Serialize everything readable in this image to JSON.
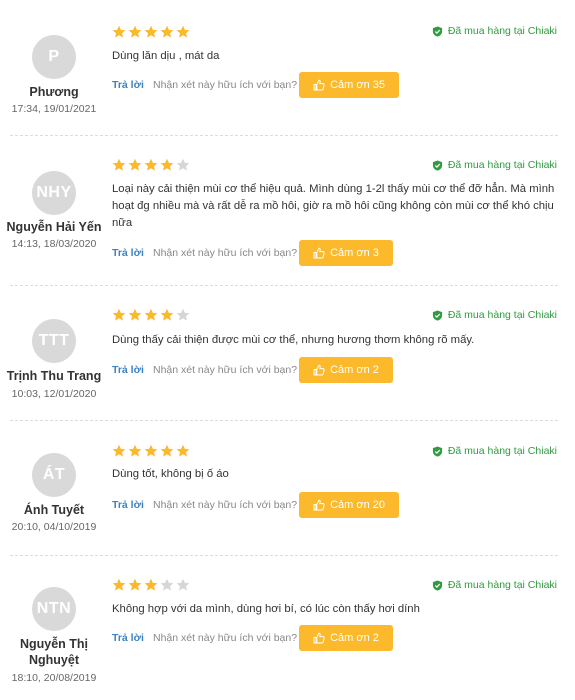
{
  "colors": {
    "star_filled": "#fbb92b",
    "star_empty": "#d6d6d6",
    "verified": "#2e9c3f",
    "reply_link": "#3b82c4",
    "thanks_button": "#fbb92b",
    "avatar_bg": "#d9d9d9"
  },
  "reviews": [
    {
      "initials": "P",
      "name_lines": [
        "Phương",
        ""
      ],
      "date": "17:34, 19/01/2021",
      "rating": 5,
      "verified_label": "Đã mua hàng tại Chiaki",
      "text": "Dùng lăn dịu , mát da",
      "reply_label": "Trả lời",
      "helpful_question": "Nhận xét này hữu ích với bạn?",
      "thanks_label": "Cảm ơn 35"
    },
    {
      "initials": "NHY",
      "name_lines": [
        "Nguyễn Hải Yến",
        ""
      ],
      "date": "14:13, 18/03/2020",
      "rating": 4,
      "verified_label": "Đã mua hàng tại Chiaki",
      "text": "Loại này cải thiện mùi cơ thể hiệu quả. Mình dùng 1-2l thấy mùi cơ thể đỡ hẳn. Mà mình hoạt đg nhiều mà và rất dễ ra mồ hôi, giờ ra mồ hôi cũng không còn mùi cơ thể khó chịu nữa",
      "reply_label": "Trả lời",
      "helpful_question": "Nhận xét này hữu ích với bạn?",
      "thanks_label": "Cảm ơn 3"
    },
    {
      "initials": "TTT",
      "name_lines": [
        "Trịnh Thu Trang",
        ""
      ],
      "date": "10:03, 12/01/2020",
      "rating": 4,
      "verified_label": "Đã mua hàng tại Chiaki",
      "text": "Dùng thấy cải thiện được mùi cơ thể, nhưng hương thơm không rõ mấy.",
      "reply_label": "Trả lời",
      "helpful_question": "Nhận xét này hữu ích với bạn?",
      "thanks_label": "Cảm ơn 2"
    },
    {
      "initials": "ÁT",
      "name_lines": [
        "Ánh Tuyết",
        ""
      ],
      "date": "20:10, 04/10/2019",
      "rating": 5,
      "verified_label": "Đã mua hàng tại Chiaki",
      "text": "Dùng tốt, không bị ố áo",
      "reply_label": "Trả lời",
      "helpful_question": "Nhận xét này hữu ích với bạn?",
      "thanks_label": "Cảm ơn 20"
    },
    {
      "initials": "NTN",
      "name_lines": [
        "Nguyễn Thị",
        "Nghuyệt"
      ],
      "date": "18:10, 20/08/2019",
      "rating": 3,
      "verified_label": "Đã mua hàng tại Chiaki",
      "text": "Không hợp với da mình, dùng hơi bí, có lúc còn thấy hơi dính",
      "reply_label": "Trả lời",
      "helpful_question": "Nhận xét này hữu ích với bạn?",
      "thanks_label": "Cảm ơn 2"
    }
  ]
}
